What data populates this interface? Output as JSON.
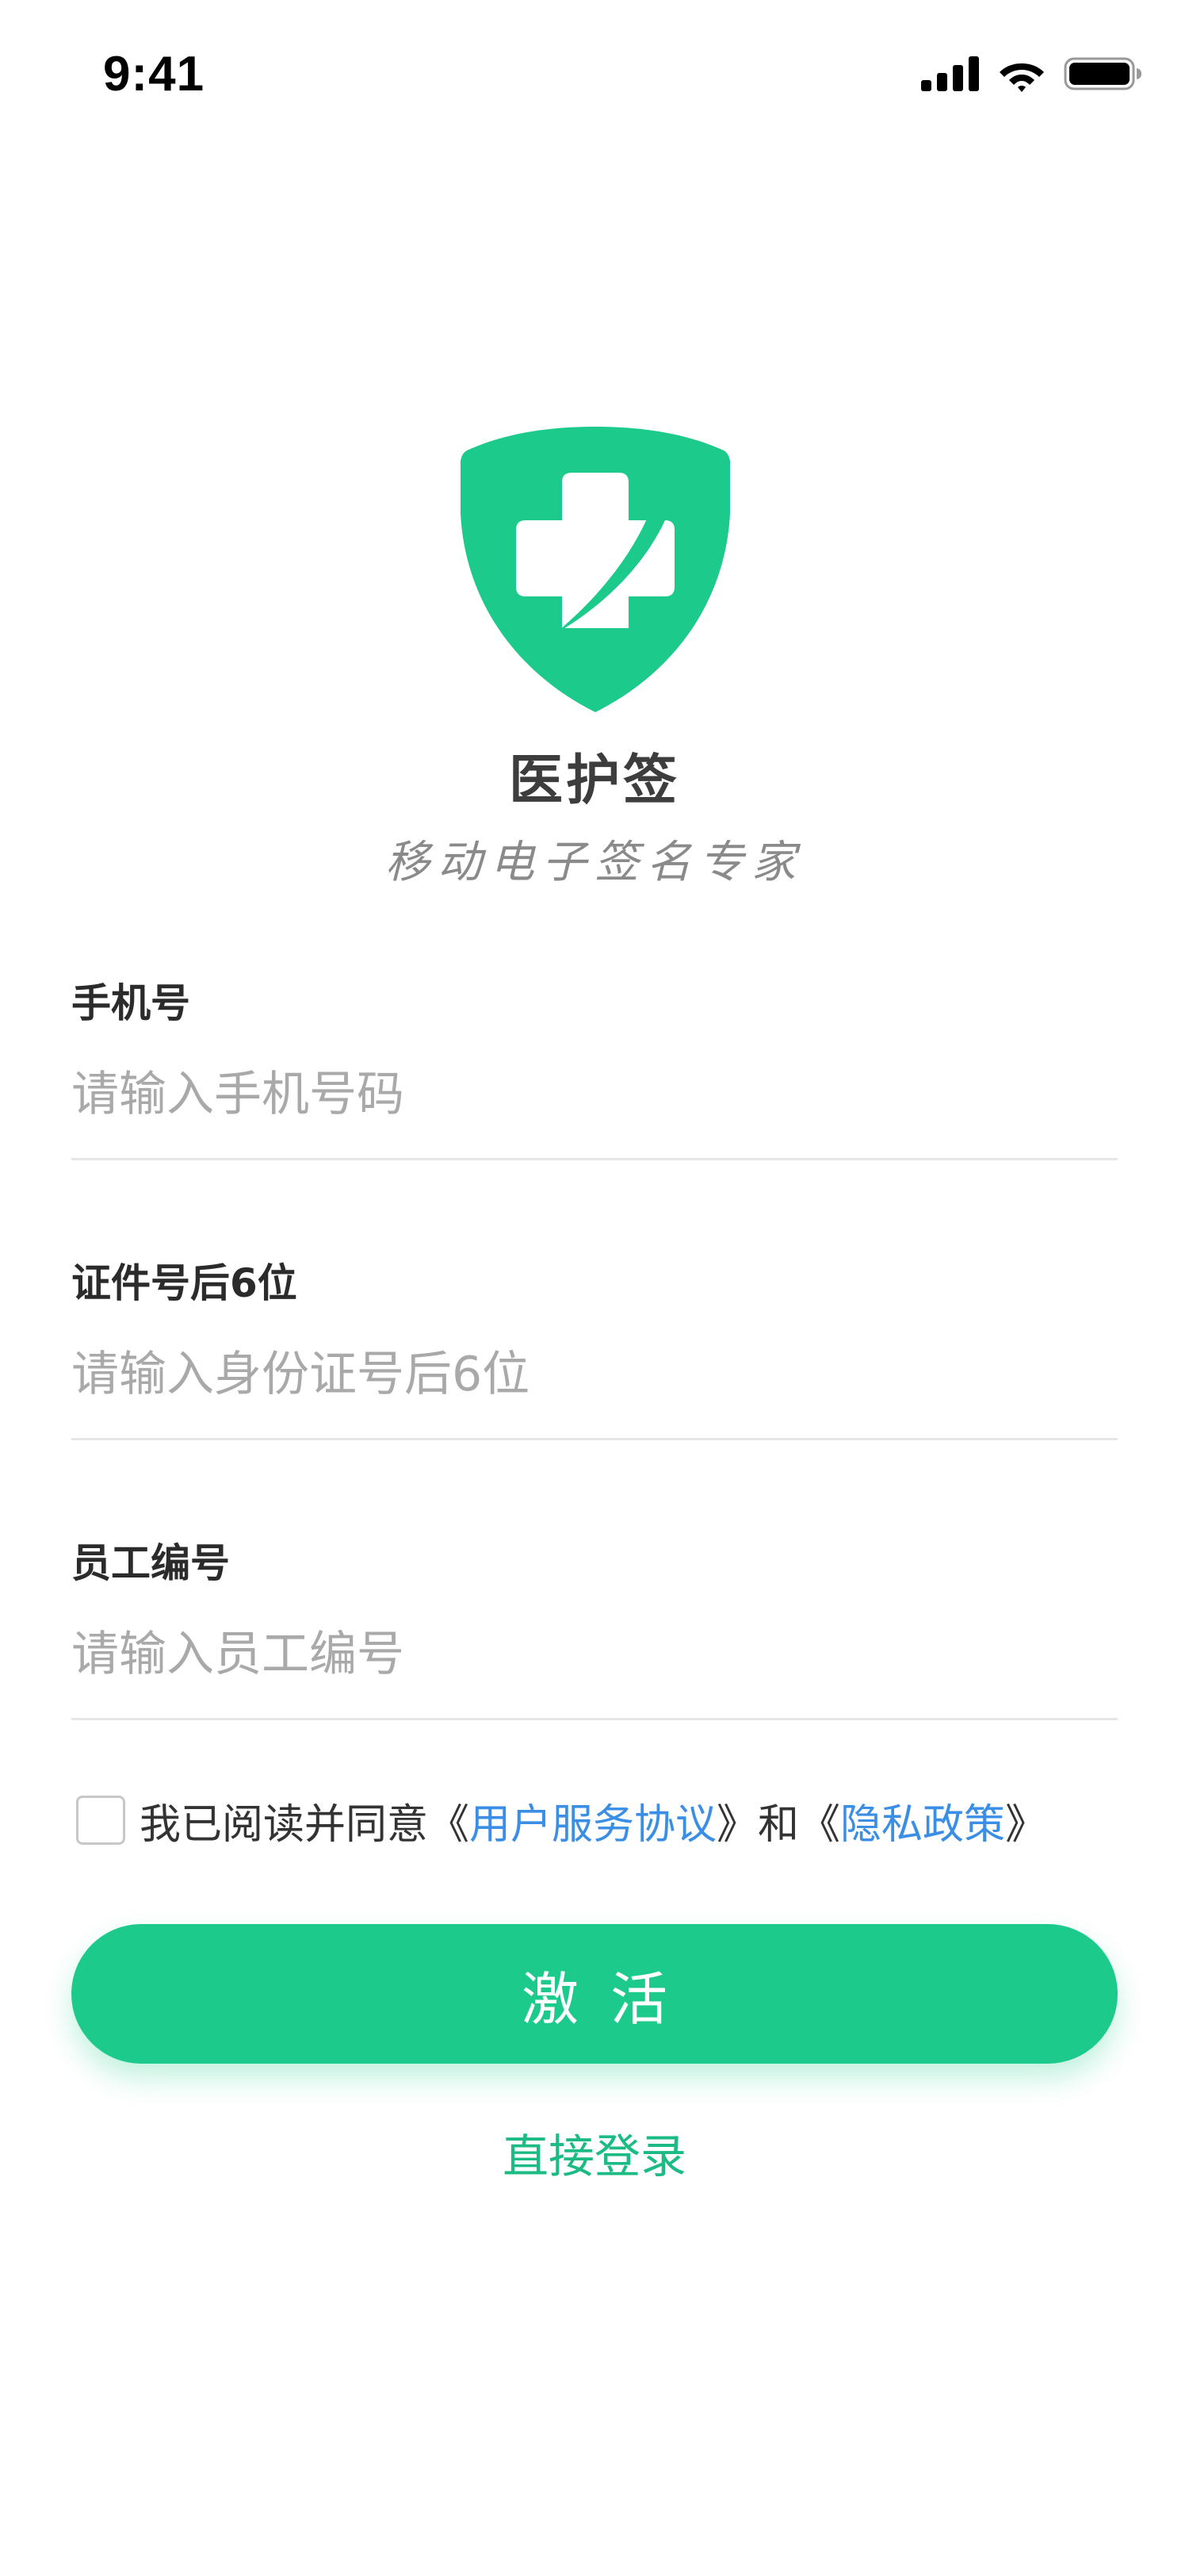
{
  "status_bar": {
    "time": "9:41",
    "icons": [
      "cellular-signal-icon",
      "wifi-icon",
      "battery-icon"
    ]
  },
  "brand": {
    "logo_icon": "medical-shield-logo",
    "name": "医护签",
    "slogan": "移动电子签名专家"
  },
  "form": {
    "phone": {
      "label": "手机号",
      "placeholder": "请输入手机号码",
      "value": ""
    },
    "id_suffix": {
      "label": "证件号后6位",
      "placeholder": "请输入身份证号后6位",
      "value": ""
    },
    "employee_no": {
      "label": "员工编号",
      "placeholder": "请输入员工编号",
      "value": ""
    }
  },
  "agreement": {
    "checked": false,
    "prefix": "我已阅读并同意《",
    "terms_link": "用户服务协议",
    "middle": "》和《",
    "privacy_link": "隐私政策",
    "suffix": "》"
  },
  "actions": {
    "activate_label": "激活",
    "direct_login_label": "直接登录"
  },
  "colors": {
    "brand_green": "#1ccb8c",
    "link_blue": "#3a8ee6",
    "placeholder_gray": "#a9a9a9"
  }
}
